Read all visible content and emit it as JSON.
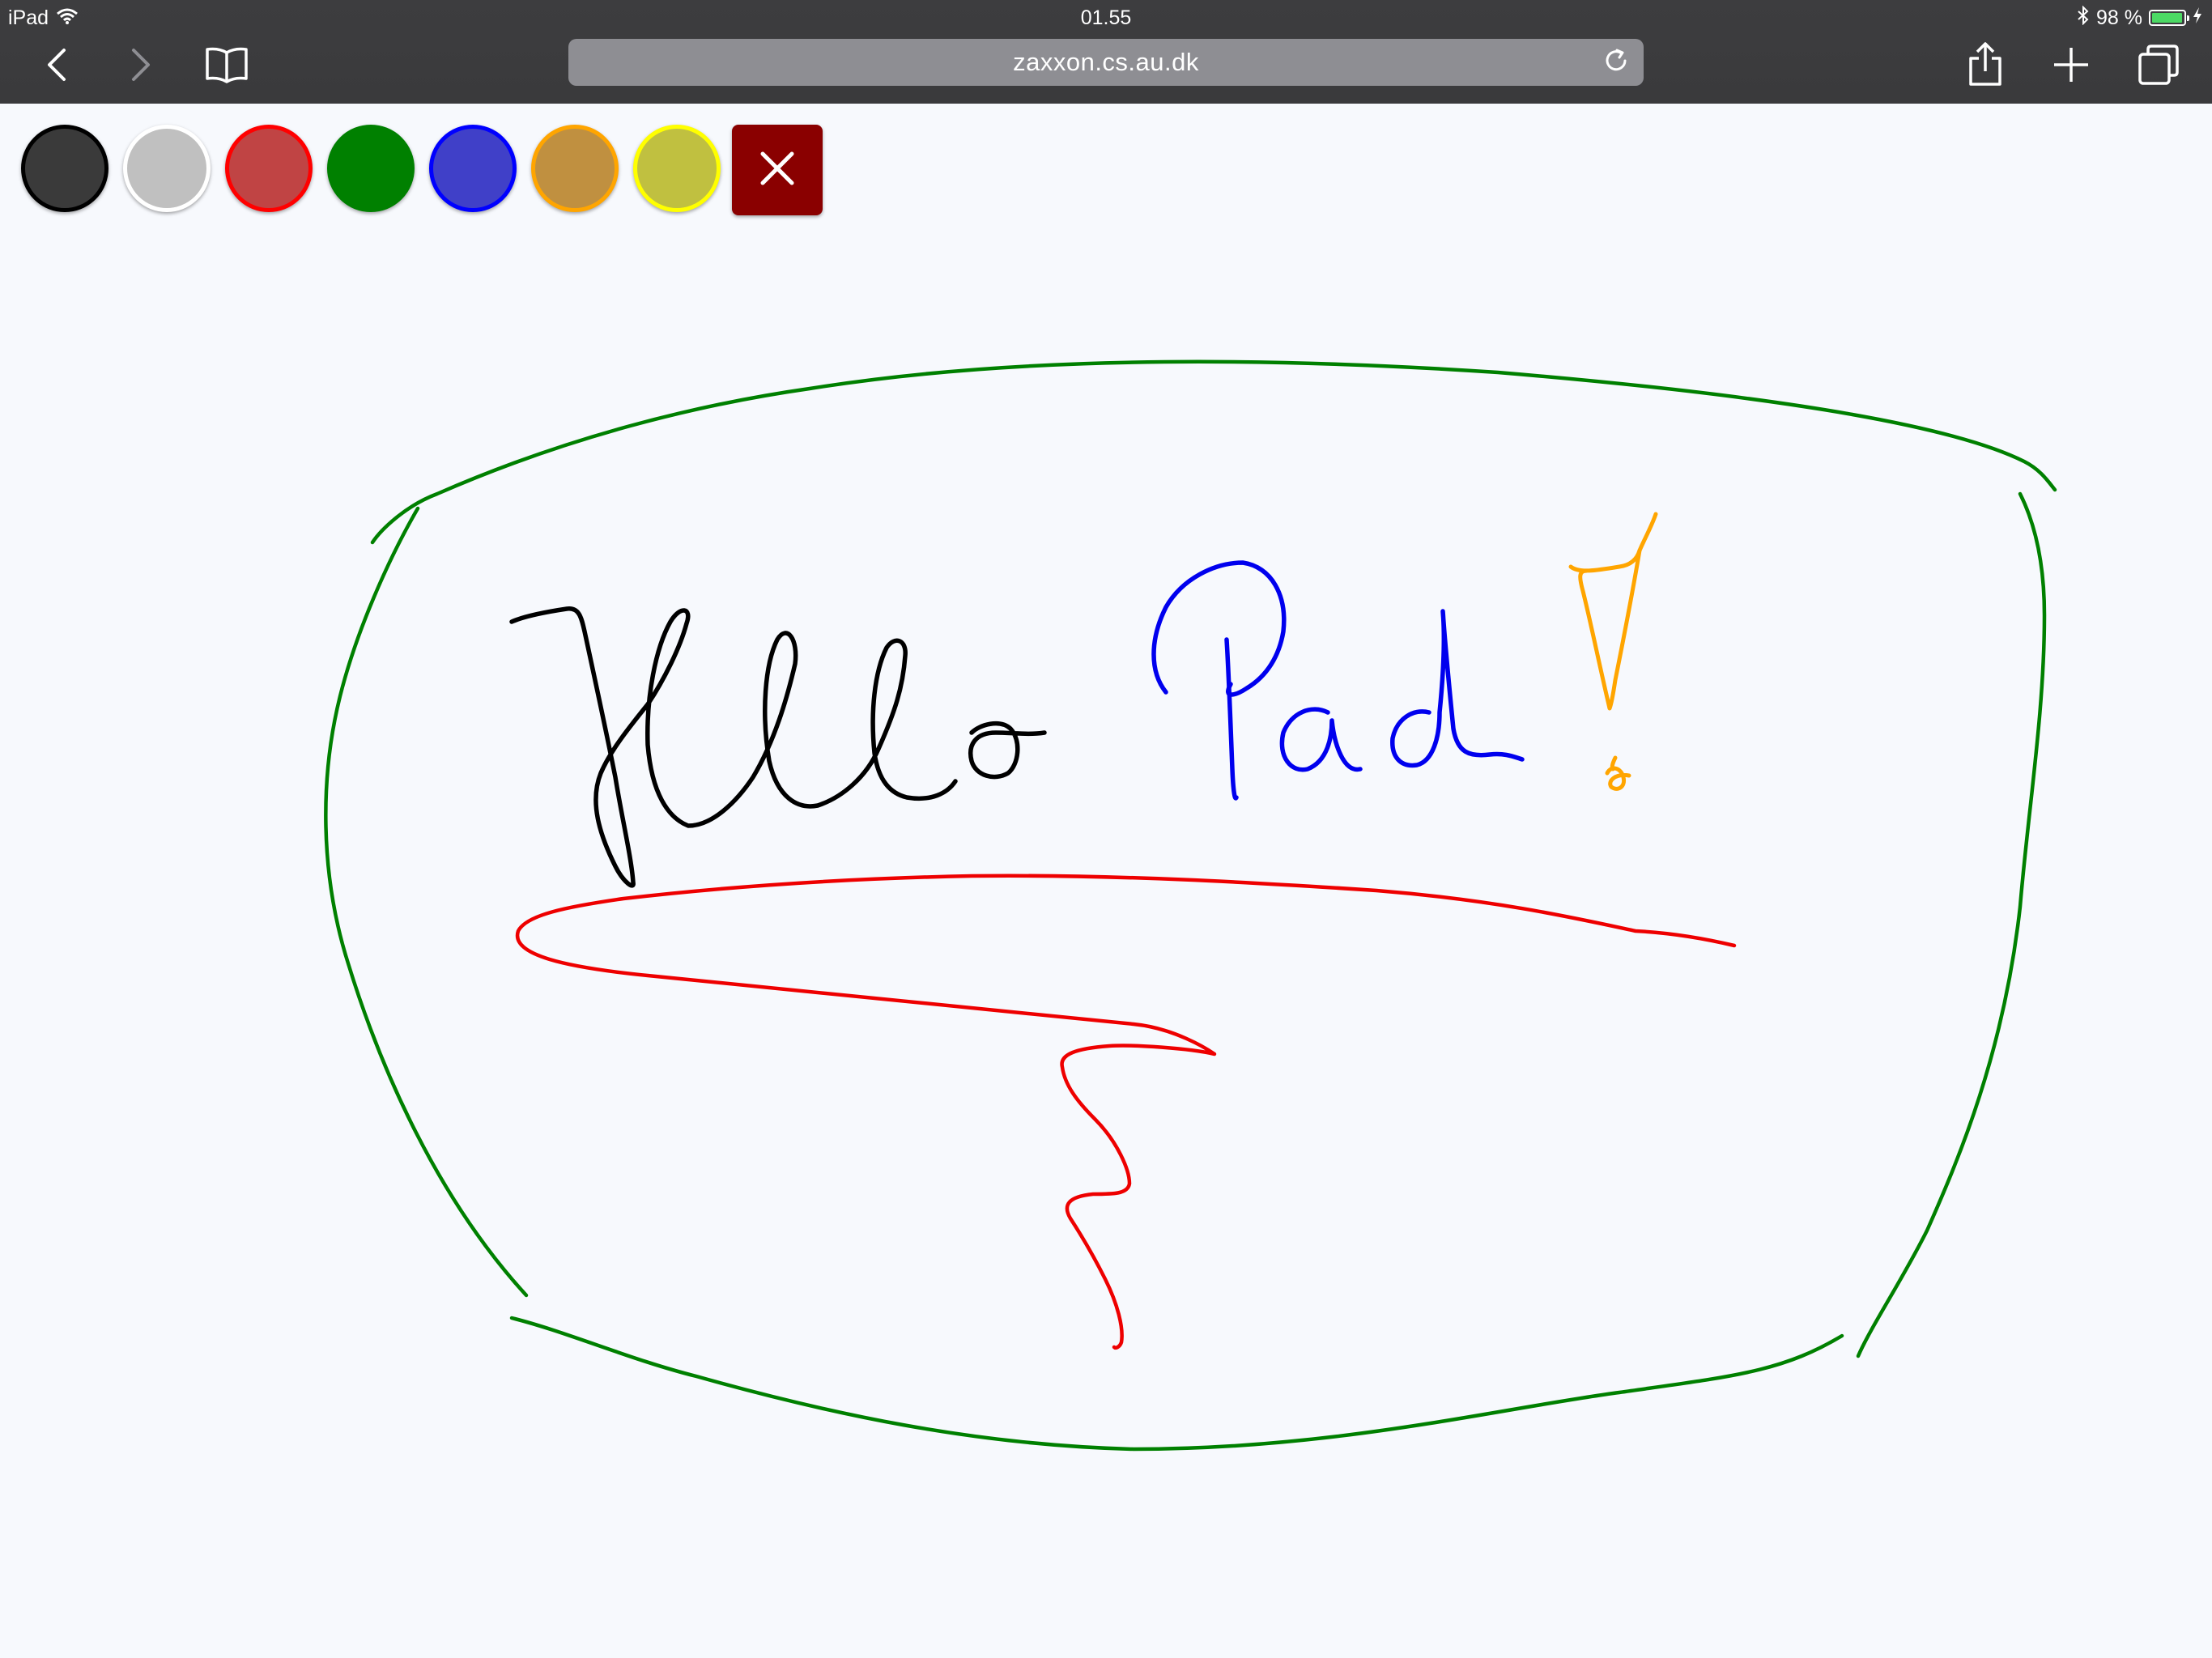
{
  "status_bar": {
    "device": "iPad",
    "time": "01.55",
    "battery": "98 %",
    "battery_level": 0.98
  },
  "browser": {
    "url": "zaxxon.cs.au.dk",
    "back_icon": "chevron-left-icon",
    "forward_icon": "chevron-right-icon",
    "bookmarks_icon": "book-icon",
    "reload_icon": "reload-icon",
    "share_icon": "share-icon",
    "new_tab_icon": "plus-icon",
    "tabs_icon": "tabs-icon"
  },
  "palette": {
    "colors": [
      {
        "name": "black",
        "fill": "#3a3a3a",
        "border": "#000000"
      },
      {
        "name": "gray",
        "fill": "#c0c0c0",
        "border": "#ffffff"
      },
      {
        "name": "red",
        "fill": "#c04444",
        "border": "#ff0000"
      },
      {
        "name": "green",
        "fill": "#008000",
        "border": "#008000"
      },
      {
        "name": "blue",
        "fill": "#4040c8",
        "border": "#0000ff"
      },
      {
        "name": "orange",
        "fill": "#c09040",
        "border": "#ffa500"
      },
      {
        "name": "yellow",
        "fill": "#c0c040",
        "border": "#ffff00"
      }
    ],
    "clear_button": {
      "fill": "#8a0000",
      "icon": "close-icon"
    }
  },
  "strokes": {
    "colors": {
      "green": "#008000",
      "black": "#000000",
      "blue": "#0000ee",
      "orange": "#ffa500",
      "red": "#ee0000"
    }
  }
}
